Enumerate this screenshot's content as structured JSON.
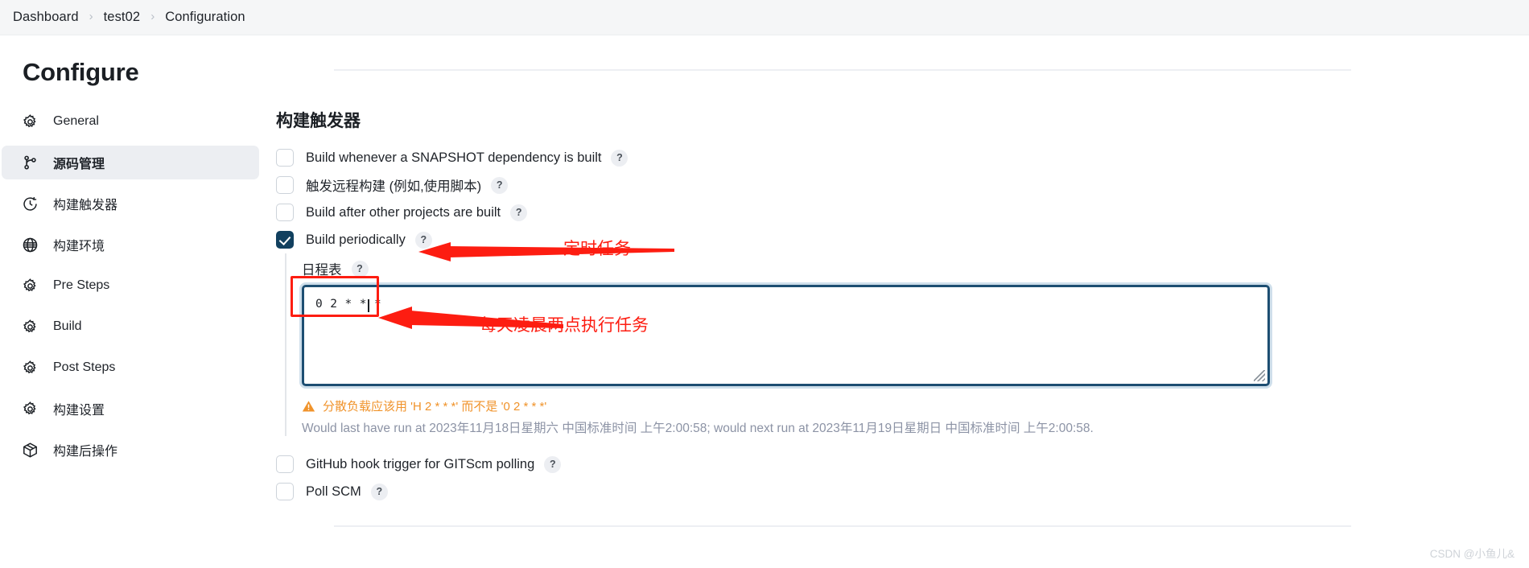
{
  "breadcrumb": {
    "items": [
      "Dashboard",
      "test02",
      "Configuration"
    ],
    "separator": "›"
  },
  "sidebar": {
    "title": "Configure",
    "items": [
      {
        "label": "General",
        "icon": "gear-icon",
        "active": false
      },
      {
        "label": "源码管理",
        "icon": "branch-icon",
        "active": true
      },
      {
        "label": "构建触发器",
        "icon": "clock-icon",
        "active": false
      },
      {
        "label": "构建环境",
        "icon": "globe-icon",
        "active": false
      },
      {
        "label": "Pre Steps",
        "icon": "gear-icon",
        "active": false
      },
      {
        "label": "Build",
        "icon": "gear-icon",
        "active": false
      },
      {
        "label": "Post Steps",
        "icon": "gear-icon",
        "active": false
      },
      {
        "label": "构建设置",
        "icon": "gear-icon",
        "active": false
      },
      {
        "label": "构建后操作",
        "icon": "box-icon",
        "active": false
      }
    ]
  },
  "main": {
    "section_title": "构建触发器",
    "help_glyph": "?",
    "triggers": [
      {
        "label": "Build whenever a SNAPSHOT dependency is built",
        "checked": false,
        "help": true
      },
      {
        "label": "触发远程构建 (例如,使用脚本)",
        "checked": false,
        "help": true
      },
      {
        "label": "Build after other projects are built",
        "checked": false,
        "help": true
      },
      {
        "label": "Build periodically",
        "checked": true,
        "help": true
      }
    ],
    "schedule": {
      "label": "日程表",
      "value": "0 2 * * *",
      "warning": "分散负载应该用 'H 2 * * *' 而不是 '0 2 * * *'",
      "info": "Would last have run at 2023年11月18日星期六 中国标准时间 上午2:00:58; would next run at 2023年11月19日星期日 中国标准时间 上午2:00:58."
    },
    "triggers_bottom": [
      {
        "label": "GitHub hook trigger for GITScm polling",
        "checked": false,
        "help": true
      },
      {
        "label": "Poll SCM",
        "checked": false,
        "help": true
      }
    ]
  },
  "annotations": {
    "periodic_note": "定时任务",
    "cron_note": "每天凌晨两点执行任务",
    "color": "#fd1d11"
  },
  "watermark": "CSDN @小鱼儿&"
}
